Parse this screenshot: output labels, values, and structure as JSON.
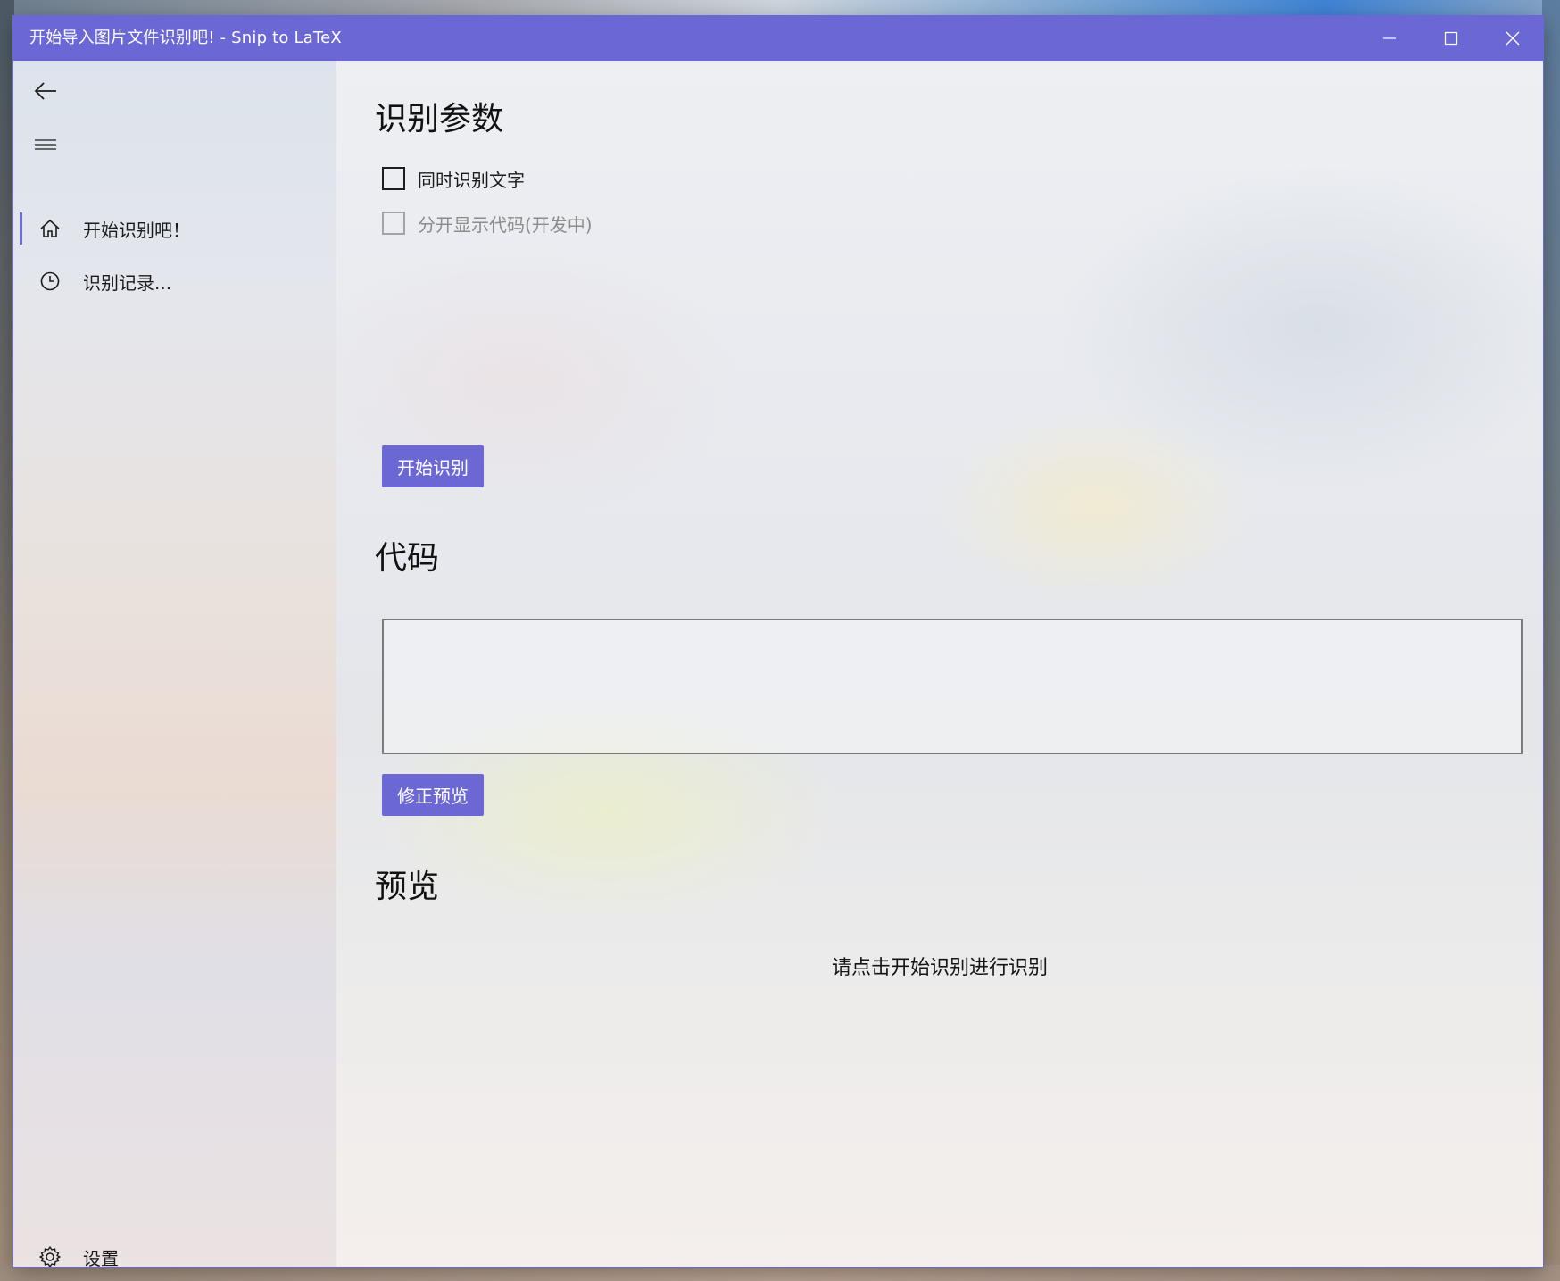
{
  "window": {
    "title": "开始导入图片文件识别吧! - Snip to LaTeX",
    "accent_color": "#6b68d6",
    "controls": [
      "minimize-icon",
      "maximize-icon",
      "close-icon"
    ]
  },
  "nav": {
    "back_icon": "back-arrow-icon",
    "menu_icon": "hamburger-menu-icon",
    "items": [
      {
        "label": "开始识别吧！",
        "icon": "home-icon",
        "selected": true
      },
      {
        "label": "识别记录...",
        "icon": "clock-icon",
        "selected": false
      }
    ],
    "footer": {
      "label": "设置",
      "icon": "gear-icon"
    }
  },
  "main": {
    "params_title": "识别参数",
    "options": [
      {
        "label": "同时识别文字",
        "checked": false,
        "enabled": true
      },
      {
        "label": "分开显示代码(开发中)",
        "checked": false,
        "enabled": false
      }
    ],
    "start_button": "开始识别",
    "code_title": "代码",
    "code_value": "",
    "fix_button": "修正预览",
    "preview_title": "预览",
    "preview_hint": "请点击开始识别进行识别"
  }
}
